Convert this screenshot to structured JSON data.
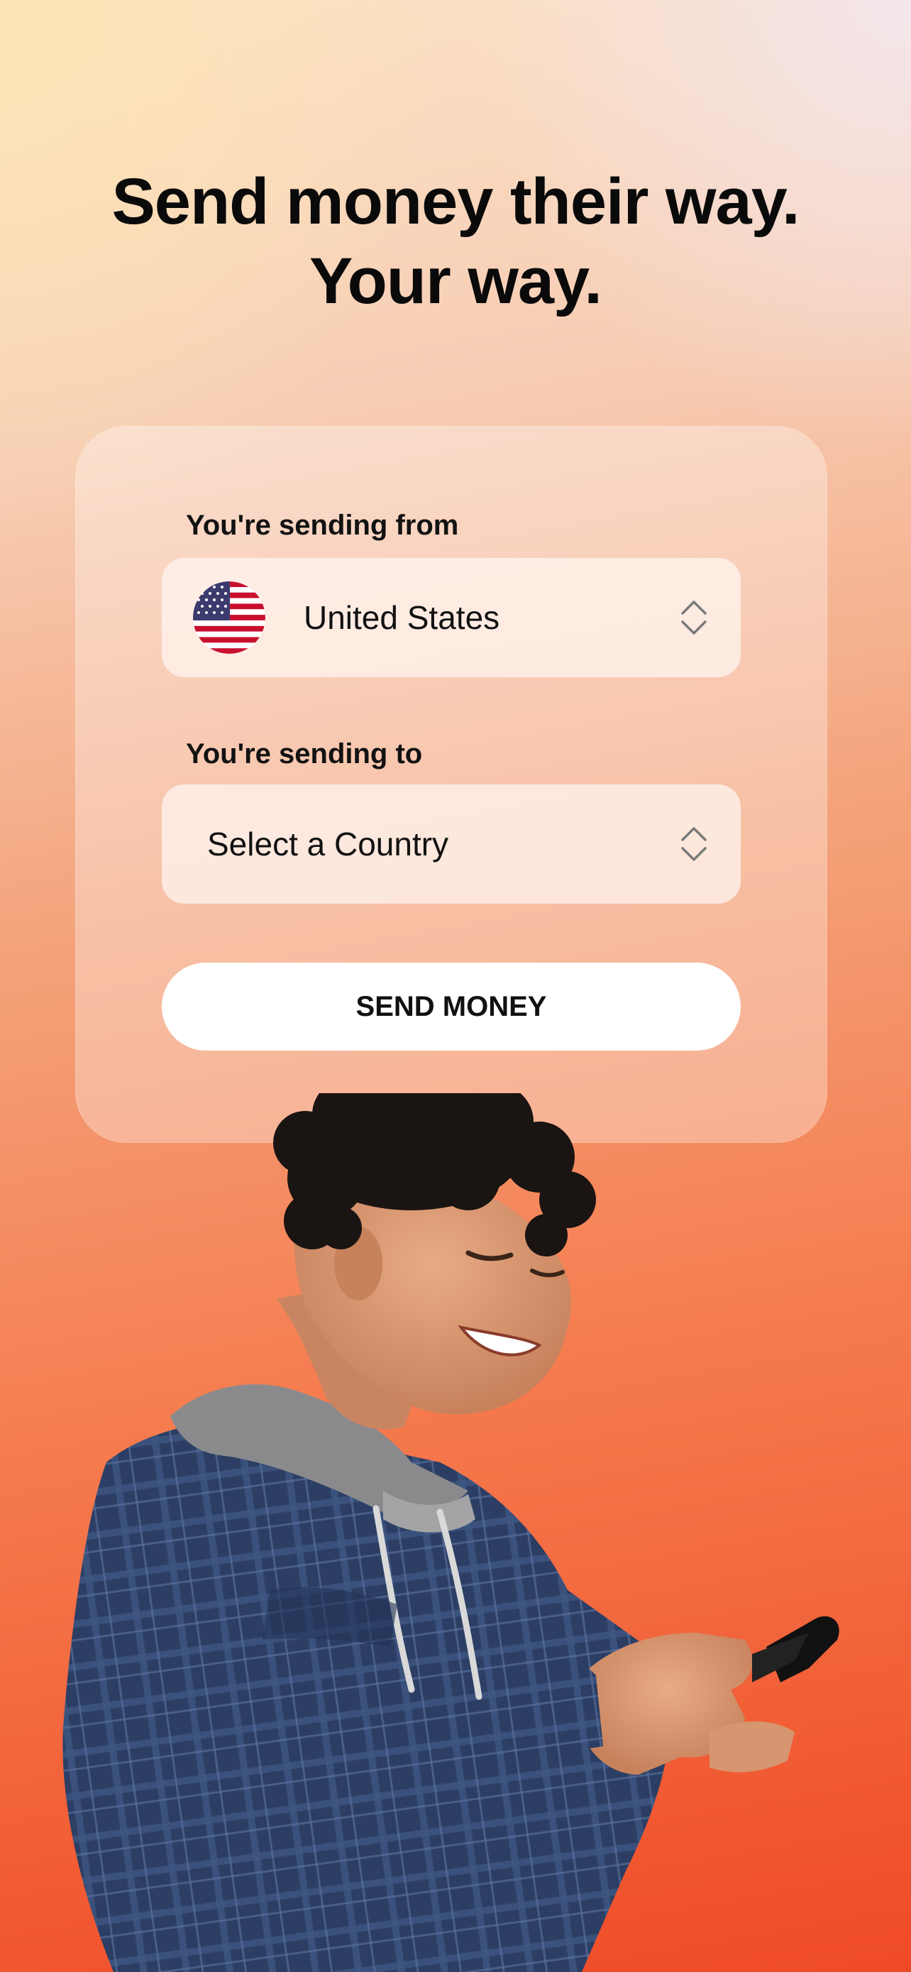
{
  "headline": {
    "line1": "Send money their way.",
    "line2": "Your way."
  },
  "form": {
    "from_label": "You're sending from",
    "from_value": "United States",
    "from_flag_icon": "us-flag-icon",
    "to_label": "You're sending to",
    "to_placeholder": "Select a Country",
    "send_button": "SEND MONEY"
  },
  "colors": {
    "gradient_top": "#fbe3c6",
    "gradient_bottom": "#ef4a26",
    "button_bg": "#ffffff",
    "text": "#0a0a0a"
  }
}
